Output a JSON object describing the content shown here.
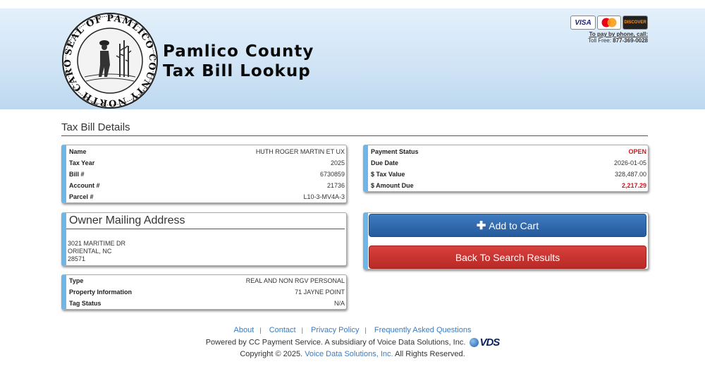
{
  "header": {
    "title_line1": "Pamlico County",
    "title_line2": "Tax Bill Lookup",
    "seal_text": "SEAL OF PAMLICO COUNTY NORTH CAROLINA",
    "pay": {
      "cards": [
        "VISA",
        "MasterCard",
        "DISCOVER"
      ],
      "phone_label": "To pay by phone, call:",
      "toll_prefix": "Toll Free:",
      "toll_number": "877-369-0028"
    }
  },
  "page": {
    "section_title": "Tax Bill Details"
  },
  "details": {
    "rows": [
      {
        "label": "Name",
        "value": "HUTH ROGER MARTIN ET UX"
      },
      {
        "label": "Tax Year",
        "value": "2025"
      },
      {
        "label": "Bill #",
        "value": "6730859"
      },
      {
        "label": "Account #",
        "value": "21736"
      },
      {
        "label": "Parcel #",
        "value": "L10-3-MV4A-3"
      }
    ]
  },
  "status": {
    "rows": [
      {
        "label": "Payment Status",
        "value": "OPEN"
      },
      {
        "label": "Due Date",
        "value": "2026-01-05"
      },
      {
        "label": "$ Tax Value",
        "value": "328,487.00"
      },
      {
        "label": "$ Amount Due",
        "value": "2,217.29"
      }
    ],
    "alert_color": "#d4141a"
  },
  "owner": {
    "heading": "Owner Mailing Address",
    "address_line1": "3021 MARITIME DR",
    "address_line2": "ORIENTAL, NC",
    "address_line3": "28571"
  },
  "property": {
    "rows": [
      {
        "label": "Type",
        "value": "REAL AND NON RGV PERSONAL"
      },
      {
        "label": "Property Information",
        "value": "71 JAYNE POINT"
      },
      {
        "label": "Tag Status",
        "value": "N/A"
      }
    ]
  },
  "actions": {
    "add_to_cart": "Add to Cart",
    "back": "Back To Search Results",
    "add_icon": "plus-icon"
  },
  "footer": {
    "links": [
      "About",
      "Contact",
      "Privacy Policy",
      "Frequently Asked Questions"
    ],
    "powered": "Powered by CC Payment Service.  A subsidiary of Voice Data Solutions, Inc.",
    "vds_logo": "VDS",
    "copyright_prefix": "Copyright © 2025.",
    "copyright_link": "Voice Data Solutions, Inc.",
    "copyright_suffix": "All Rights Reserved."
  },
  "colors": {
    "accent_blue": "#245a9c",
    "danger_red": "#b82a26",
    "panel_border": "#6fb6e8"
  }
}
